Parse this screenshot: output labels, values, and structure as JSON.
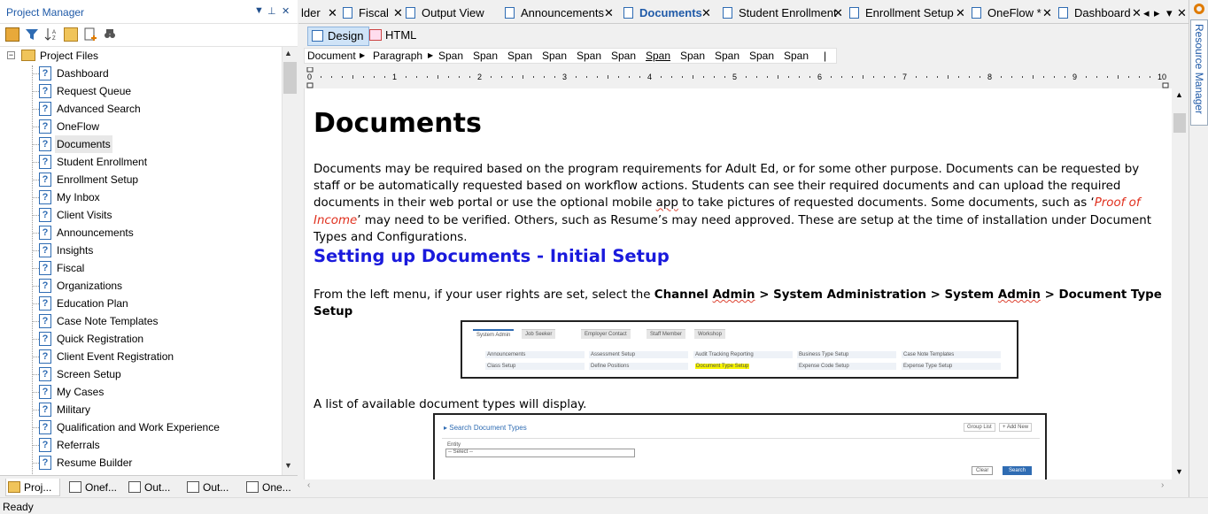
{
  "project_panel": {
    "title": "Project Manager",
    "pin": "↓",
    "pin2": "⬆",
    "close": "✕",
    "root": "Project Files",
    "items": [
      "Dashboard",
      "Request Queue",
      "Advanced Search",
      "OneFlow",
      "Documents",
      "Student Enrollment",
      "Enrollment Setup",
      "My Inbox",
      "Client Visits",
      "Announcements",
      "Insights",
      "Fiscal",
      "Organizations",
      "Education Plan",
      "Case Note Templates",
      "Quick Registration",
      "Client Event Registration",
      "Screen Setup",
      "My Cases",
      "Military",
      "Qualification and Work Experience",
      "Referrals",
      "Resume Builder"
    ],
    "selected": "Documents",
    "bottom_tabs": [
      "Proj...",
      "Onef...",
      "Out...",
      "Out...",
      "One..."
    ]
  },
  "doc_tabs": [
    "lder",
    "Fiscal",
    "Output View",
    "Announcements",
    "Documents",
    "Student Enrollment",
    "Enrollment Setup",
    "OneFlow *",
    "Dashboard"
  ],
  "active_tab": "Documents",
  "resource_manager": "Resource Manager",
  "view_buttons": {
    "design": "Design",
    "html": "HTML"
  },
  "breadcrumb": [
    "Document",
    "Paragraph",
    "Span",
    "Span",
    "Span",
    "Span",
    "Span",
    "Span",
    "Span",
    "Span",
    "Span",
    "Span",
    "Span",
    "|"
  ],
  "ruler_numbers": [
    "0",
    "1",
    "2",
    "3",
    "4",
    "5",
    "6",
    "7",
    "8",
    "9",
    "10"
  ],
  "document": {
    "title": "Documents",
    "para1_a": "Documents may be required based on the program requirements for Adult Ed, or for some other purpose. Documents can be requested by staff or be automatically requested based on workflow actions.  Students can see their required documents and can upload the required documents in their web portal or use the optional mobile ",
    "para1_app": "app",
    "para1_b": " to take pictures of requested documents.  Some documents, such as ‘",
    "para1_red": "Proof of Income",
    "para1_c": "’ may need to be verified.  Others, such as Resume’s may need approved.  These are setup at the time of installation under Document Types and Configurations.",
    "heading2": "Setting up Documents - Initial Setup",
    "para2_a": "From the left menu, if your user rights are set, select the ",
    "para2_b1": "Channel ",
    "para2_admin1": "Admin",
    "para2_b2": " > System Administration > System ",
    "para2_admin2": "Admin",
    "para2_b3": " > Document Type Setup",
    "para3": "A list of available document types will display."
  },
  "shot1": {
    "tabs": [
      "System Admin",
      "Job Seeker",
      "Employer Contact",
      "Staff Member",
      "Workshop"
    ],
    "row1": [
      "Announcements",
      "Assessment Setup",
      "Audit Tracking Reporting",
      "Business Type Setup",
      "Case Note Templates"
    ],
    "row2": [
      "Class Setup",
      "Define Positions",
      "Document Type Setup",
      "Expense Code Setup",
      "Expense Type Setup"
    ]
  },
  "shot2": {
    "title": "Search Document Types",
    "group_list": "Group List",
    "add_new": "+ Add New",
    "entity_label": "Entity",
    "select": "-- Select --",
    "clear": "Clear",
    "search": "Search"
  },
  "status": "Ready"
}
